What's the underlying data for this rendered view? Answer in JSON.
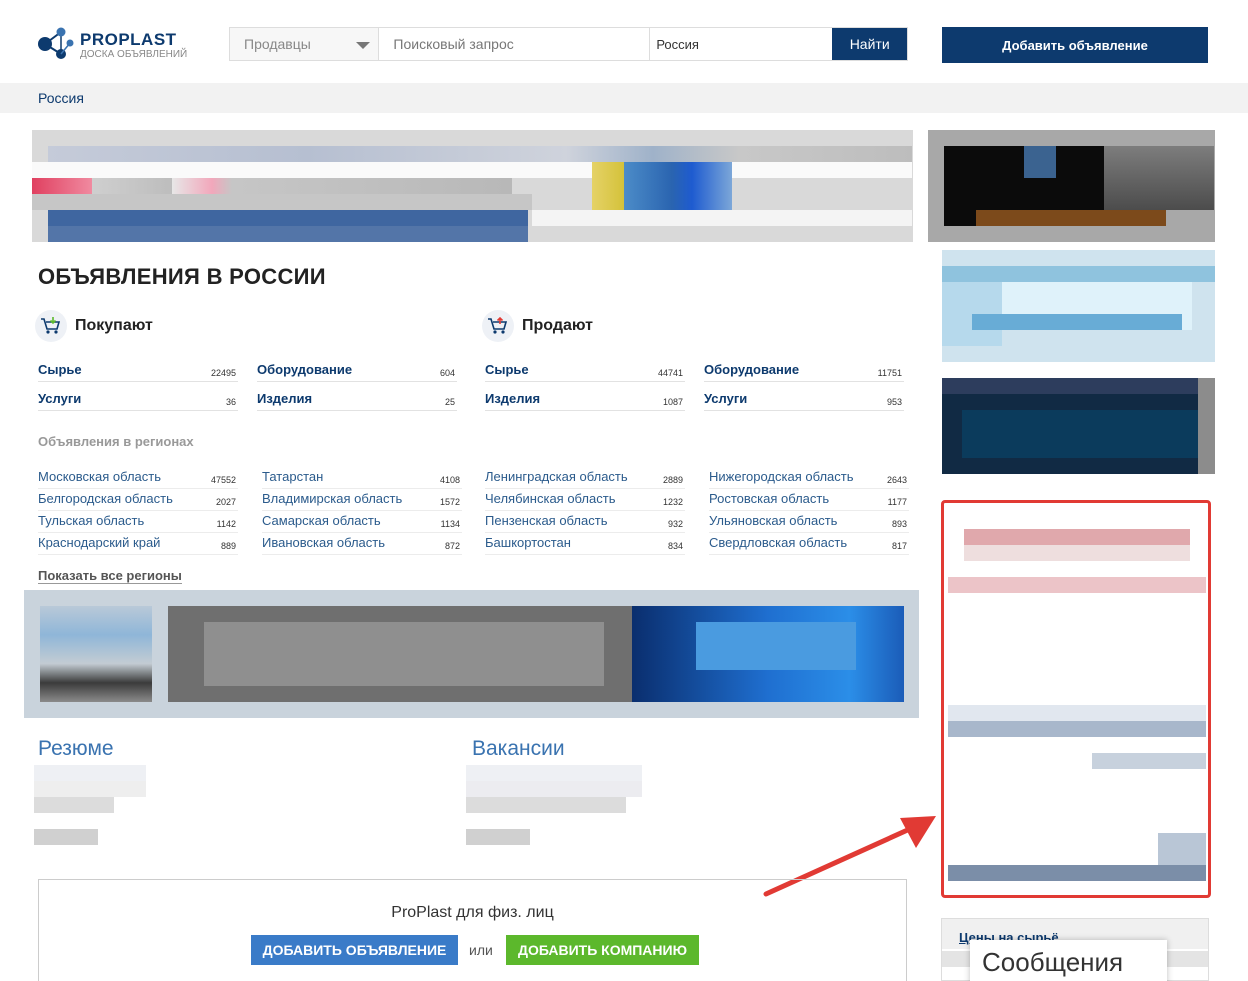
{
  "header": {
    "logo_title": "PROPLAST",
    "logo_subtitle": "ДОСКА ОБЪЯВЛЕНИЙ",
    "search_category": "Продавцы",
    "search_placeholder": "Поисковый запрос",
    "search_region": "Россия",
    "search_button": "Найти",
    "add_button": "Добавить объявление"
  },
  "breadcrumb": "Россия",
  "page_title": "ОБЪЯВЛЕНИЯ В РОССИИ",
  "buy": {
    "title": "Покупают",
    "items": [
      {
        "label": "Сырье",
        "count": "22495"
      },
      {
        "label": "Оборудование",
        "count": "604"
      },
      {
        "label": "Услуги",
        "count": "36"
      },
      {
        "label": "Изделия",
        "count": "25"
      }
    ]
  },
  "sell": {
    "title": "Продают",
    "items": [
      {
        "label": "Сырье",
        "count": "44741"
      },
      {
        "label": "Оборудование",
        "count": "11751"
      },
      {
        "label": "Изделия",
        "count": "1087"
      },
      {
        "label": "Услуги",
        "count": "953"
      }
    ]
  },
  "regions": {
    "title": "Объявления в регионах",
    "items": [
      {
        "label": "Московская область",
        "count": "47552"
      },
      {
        "label": "Татарстан",
        "count": "4108"
      },
      {
        "label": "Ленинградская область",
        "count": "2889"
      },
      {
        "label": "Нижегородская область",
        "count": "2643"
      },
      {
        "label": "Белгородская область",
        "count": "2027"
      },
      {
        "label": "Владимирская область",
        "count": "1572"
      },
      {
        "label": "Челябинская область",
        "count": "1232"
      },
      {
        "label": "Ростовская область",
        "count": "1177"
      },
      {
        "label": "Тульская область",
        "count": "1142"
      },
      {
        "label": "Самарская область",
        "count": "1134"
      },
      {
        "label": "Пензенская область",
        "count": "932"
      },
      {
        "label": "Ульяновская область",
        "count": "893"
      },
      {
        "label": "Краснодарский край",
        "count": "889"
      },
      {
        "label": "Ивановская область",
        "count": "872"
      },
      {
        "label": "Башкортостан",
        "count": "834"
      },
      {
        "label": "Свердловская область",
        "count": "817"
      }
    ],
    "show_all": "Показать все регионы"
  },
  "resume_title": "Резюме",
  "vacancies_title": "Вакансии",
  "promo": {
    "title": "ProPlast для физ. лиц",
    "add_ad": "ДОБАВИТЬ ОБЪЯВЛЕНИЕ",
    "or": "или",
    "add_company": "ДОБАВИТЬ КОМПАНИЮ"
  },
  "sidebar": {
    "prices_title": "Цены на сырьё",
    "messages_tab": "Сообщения"
  },
  "colors": {
    "brand": "#0d3a6e",
    "link": "#3a73b0",
    "highlight": "#e13a34",
    "green": "#5cb82c",
    "blue_button": "#3a7bc8"
  }
}
